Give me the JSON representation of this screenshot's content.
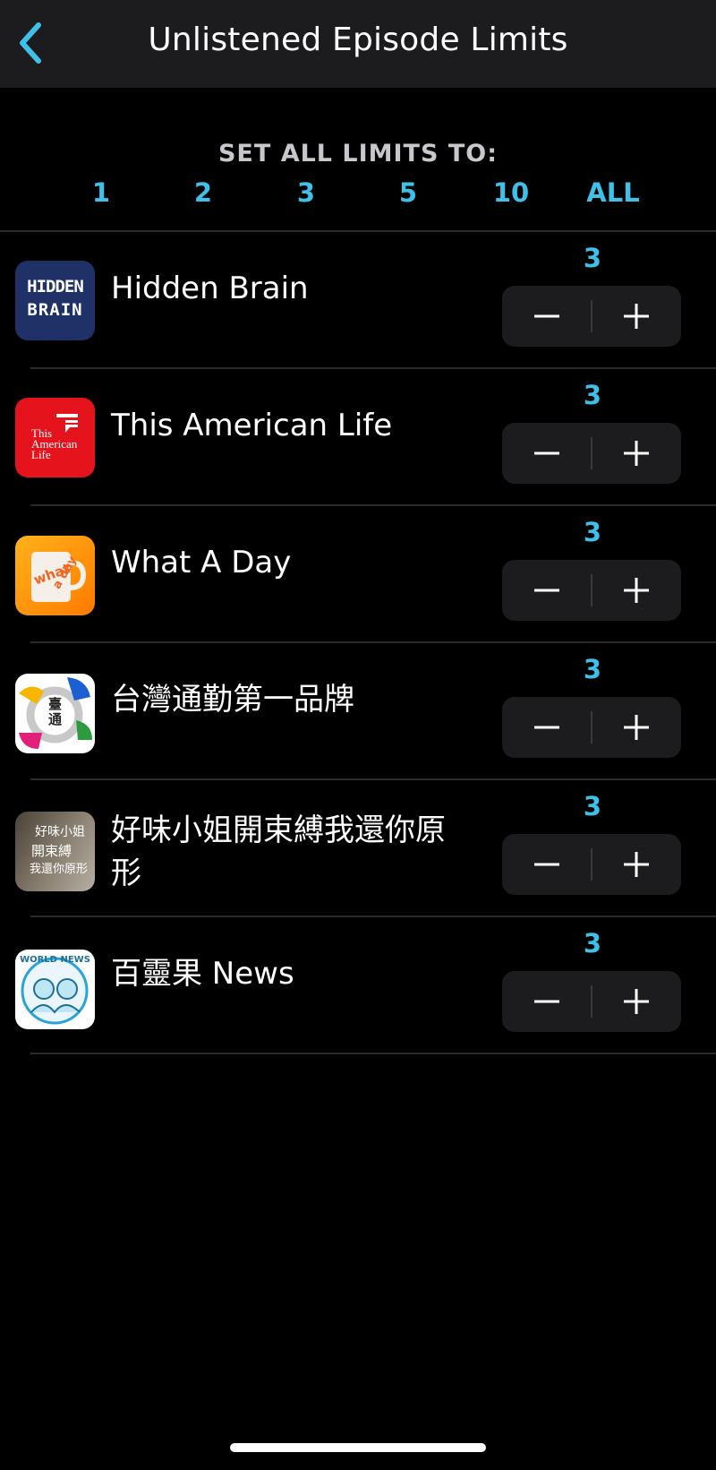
{
  "header": {
    "title": "Unlistened Episode Limits",
    "back_icon": "chevron-left-icon"
  },
  "set_all": {
    "label": "SET ALL LIMITS TO:",
    "options": [
      "1",
      "2",
      "3",
      "5",
      "10",
      "ALL"
    ]
  },
  "colors": {
    "accent": "#3fc0e8",
    "background": "#000000",
    "bar": "#1c1c1e"
  },
  "podcasts": [
    {
      "name": "Hidden Brain",
      "limit": "3",
      "art_text_1": "HIDDEN",
      "art_text_2": "BRAIN"
    },
    {
      "name": "This American Life",
      "limit": "3",
      "art_text_1": "This",
      "art_text_2": "American",
      "art_text_3": "Life"
    },
    {
      "name": "What A Day",
      "limit": "3",
      "art_text_1": "what",
      "art_text_2": "a day"
    },
    {
      "name": "台灣通勤第一品牌",
      "limit": "3",
      "art_text_1": "臺",
      "art_text_2": "通"
    },
    {
      "name": "好味小姐開束縛我還你原形",
      "limit": "3",
      "art_text_1": "好味小姐",
      "art_text_2": "開束縛",
      "art_text_3": "我還你原形"
    },
    {
      "name": "百靈果 News",
      "limit": "3",
      "art_text_1": "WORLD NEWS"
    }
  ],
  "stepper": {
    "minus_icon": "minus-icon",
    "plus_icon": "plus-icon"
  }
}
